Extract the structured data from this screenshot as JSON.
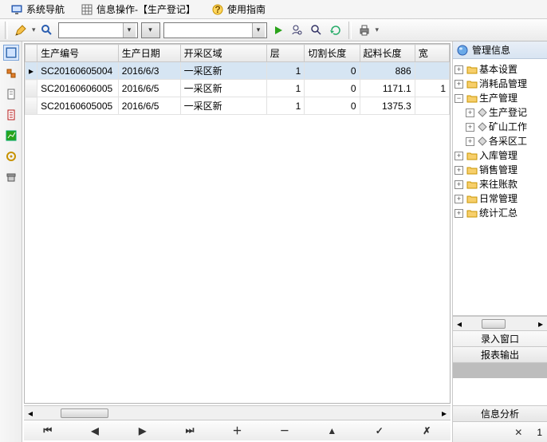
{
  "tabs": {
    "nav": "系统导航",
    "info": "信息操作-【生产登记】",
    "guide": "使用指南"
  },
  "grid": {
    "headers": [
      "生产编号",
      "生产日期",
      "开采区域",
      "层",
      "切割长度",
      "起料长度",
      "宽"
    ],
    "rows": [
      {
        "id": "SC20160605004",
        "date": "2016/6/3",
        "area": "一采区新",
        "layer": "1",
        "cut": "0",
        "mat": "886",
        "w": ""
      },
      {
        "id": "SC20160606005",
        "date": "2016/6/5",
        "area": "一采区新",
        "layer": "1",
        "cut": "0",
        "mat": "1171.1",
        "w": "1"
      },
      {
        "id": "SC20160605005",
        "date": "2016/6/5",
        "area": "一采区新",
        "layer": "1",
        "cut": "0",
        "mat": "1375.3",
        "w": ""
      }
    ]
  },
  "tree": {
    "title": "管理信息",
    "nodes": {
      "basic": "基本设置",
      "consumable": "消耗品管理",
      "production": "生产管理",
      "prod_reg": "生产登记",
      "mine_work": "矿山工作",
      "area_work": "各采区工",
      "inbound": "入库管理",
      "sales": "销售管理",
      "accounts": "来往账款",
      "daily": "日常管理",
      "stats": "统计汇总"
    }
  },
  "right_sections": {
    "entry": "录入窗口",
    "report": "报表输出",
    "analysis": "信息分析"
  },
  "footer_page": "1"
}
